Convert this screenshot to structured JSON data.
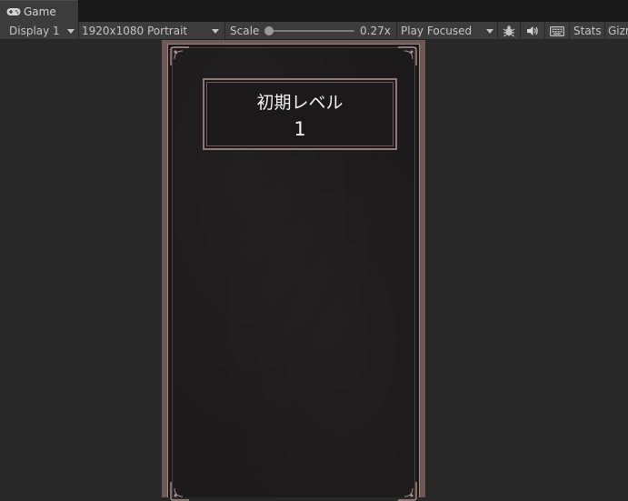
{
  "tab": {
    "label": "Game",
    "icon": "gamepad-icon"
  },
  "toolbar": {
    "display": "Display 1",
    "resolution": "1920x1080 Portrait",
    "scale_label": "Scale",
    "scale_value": "0.27x",
    "scale_fraction": 0.0,
    "play_mode": "Play Focused",
    "stats_label": "Stats",
    "gizmos_label": "Gizmos"
  },
  "game": {
    "level_title": "初期レベル",
    "level_value": "1"
  },
  "colors": {
    "toolbar_bg": "#3c3c3c",
    "viewport_bg": "#282828",
    "frame_border": "#8d7a76"
  }
}
